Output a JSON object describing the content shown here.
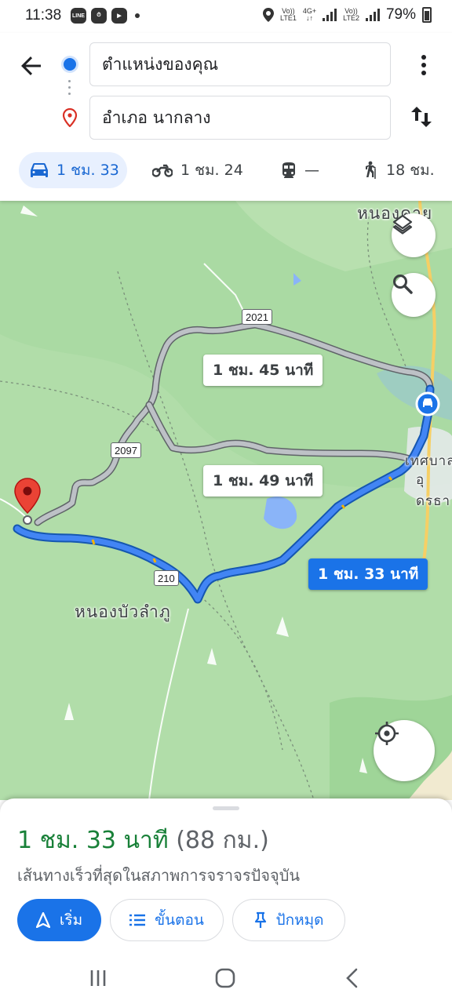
{
  "status_bar": {
    "time": "11:38",
    "network1_top": "Vo))",
    "network1_mid": "4G+",
    "network1_bot": "LTE1",
    "network2_top": "Vo))",
    "network2_bot": "LTE2",
    "battery": "79%",
    "app_badges": [
      "LINE",
      "⏱",
      "▶"
    ]
  },
  "header": {
    "origin": "ตำแหน่งของคุณ",
    "destination": "อำเภอ นากลาง",
    "modes": [
      {
        "name": "car",
        "label": "1 ชม. 33",
        "active": true
      },
      {
        "name": "motorbike",
        "label": "1 ชม. 24",
        "active": false
      },
      {
        "name": "transit",
        "label": "—",
        "active": false
      },
      {
        "name": "walk",
        "label": "18 ชม.",
        "active": false
      }
    ]
  },
  "map": {
    "place_labels": {
      "top_right": "หนองคาย",
      "bottom": "หนองบัวลำภู",
      "right_1": "เทศบาล",
      "right_2": "อุดรธา"
    },
    "road_shields": [
      "2021",
      "2097",
      "210"
    ],
    "routes": [
      {
        "label": "1 ชม. 45 นาที",
        "primary": false
      },
      {
        "label": "1 ชม. 49 นาที",
        "primary": false
      },
      {
        "label": "1 ชม. 33 นาที",
        "primary": true
      }
    ],
    "colors": {
      "map_bg": "#aadaa3",
      "route_primary": "#1a73e8",
      "route_alt": "#9e9e9e"
    }
  },
  "sheet": {
    "duration": "1 ชม. 33 นาที",
    "distance": "(88 กม.)",
    "description": "เส้นทางเร็วที่สุดในสภาพการจราจรปัจจุบัน",
    "start_label": "เริ่ม",
    "steps_label": "ขั้นตอน",
    "pin_label": "ปักหมุด"
  }
}
